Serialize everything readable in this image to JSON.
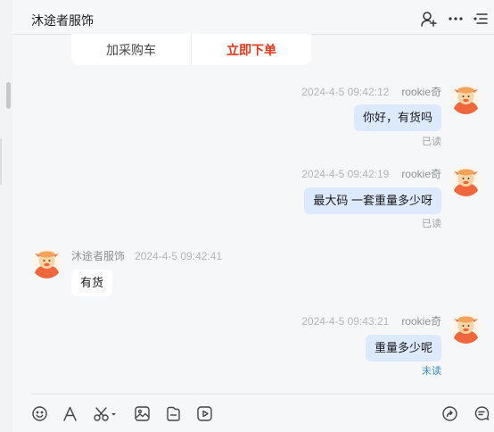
{
  "header": {
    "title": "沐途者服饰",
    "icons": [
      "add-contact-icon",
      "more-icon",
      "list-menu-icon"
    ]
  },
  "order_card": {
    "add_cart_label": "加采购车",
    "buy_now_label": "立即下单",
    "buy_color": "#e4361b"
  },
  "messages": [
    {
      "direction": "out",
      "time": "2024-4-5 09:42:12",
      "sender": "rookie奇",
      "text": "你好，有货吗",
      "status": "已读"
    },
    {
      "direction": "out",
      "time": "2024-4-5 09:42:19",
      "sender": "rookie奇",
      "text": "最大码 一套重量多少呀",
      "status": "已读"
    },
    {
      "direction": "in",
      "time": "2024-4-5 09:42:41",
      "sender": "沐途者服饰",
      "text": "有货"
    },
    {
      "direction": "out",
      "time": "2024-4-5 09:43:21",
      "sender": "rookie奇",
      "text": "重量多少呢",
      "status": "未读"
    }
  ],
  "colors": {
    "outgoing_bubble": "#dce9fe",
    "incoming_bubble": "#ffffff",
    "unread_status": "#3f8bd8",
    "panel_bg": "#f6f7f9"
  },
  "toolbar": {
    "icons": [
      "emoji-icon",
      "font-icon",
      "screenshot-scissors-icon",
      "image-icon",
      "file-icon",
      "video-icon",
      "share-icon",
      "quick-reply-icon"
    ]
  }
}
